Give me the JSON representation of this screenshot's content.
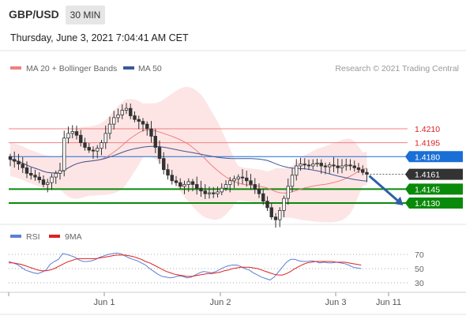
{
  "header": {
    "pair": "GBP/USD",
    "timeframe": "30 MIN"
  },
  "datetime": "Thursday, June 3, 2021 7:04:41 AM CET",
  "legend": {
    "bollinger": {
      "label": "MA 20 + Bollinger Bands",
      "color": "#f08080"
    },
    "ma50": {
      "label": "MA 50",
      "color": "#3b5998"
    },
    "credit": "Research © 2021 Trading Central"
  },
  "rsi_legend": {
    "rsi": {
      "label": "RSI",
      "color": "#5b7fd6"
    },
    "ma9": {
      "label": "9MA",
      "color": "#e02020"
    }
  },
  "colors": {
    "support": "#0a8a0a",
    "resistance": "#f08080",
    "pivot": "#1a6fd6",
    "last": "#333333",
    "arrow": "#2e5fa8"
  },
  "chart_data": {
    "type": "candlestick",
    "price_range": [
      1.4085,
      1.4265
    ],
    "x_labels": [
      "Jun 1",
      "Jun 2",
      "Jun 3",
      "Jun 11"
    ],
    "levels": [
      {
        "value": "1.4210",
        "kind": "resistance"
      },
      {
        "value": "1.4195",
        "kind": "resistance"
      },
      {
        "value": "1.4180",
        "kind": "pivot"
      },
      {
        "value": "1.4161",
        "kind": "last"
      },
      {
        "value": "1.4145",
        "kind": "support"
      },
      {
        "value": "1.4130",
        "kind": "support"
      }
    ],
    "forecast": "down toward 1.4130",
    "closes": [
      1.4177,
      1.4175,
      1.4172,
      1.4168,
      1.4162,
      1.416,
      1.4158,
      1.4155,
      1.415,
      1.4152,
      1.4158,
      1.4162,
      1.4165,
      1.42,
      1.4205,
      1.4207,
      1.4203,
      1.4195,
      1.419,
      1.4187,
      1.4186,
      1.4189,
      1.4195,
      1.4205,
      1.4215,
      1.4222,
      1.4225,
      1.423,
      1.4232,
      1.4224,
      1.422,
      1.4218,
      1.4215,
      1.421,
      1.4202,
      1.419,
      1.4178,
      1.4166,
      1.416,
      1.4154,
      1.4152,
      1.4148,
      1.415,
      1.4153,
      1.415,
      1.4146,
      1.4143,
      1.414,
      1.4141,
      1.414,
      1.4142,
      1.4146,
      1.415,
      1.4154,
      1.4156,
      1.4158,
      1.4157,
      1.4154,
      1.415,
      1.4145,
      1.414,
      1.4132,
      1.4125,
      1.4115,
      1.4112,
      1.4122,
      1.4135,
      1.4148,
      1.416,
      1.417,
      1.4172,
      1.4171,
      1.417,
      1.4172,
      1.4173,
      1.417,
      1.4169,
      1.4171,
      1.417,
      1.4168,
      1.417,
      1.4171,
      1.417,
      1.4168,
      1.4166,
      1.4163,
      1.4161
    ],
    "rsi": {
      "levels": [
        70,
        50,
        30
      ],
      "rsi_values": [
        60,
        58,
        56,
        52,
        48,
        46,
        44,
        43,
        45,
        48,
        56,
        60,
        63,
        71,
        70,
        68,
        66,
        62,
        60,
        60,
        61,
        63,
        66,
        68,
        70,
        71,
        72,
        71,
        68,
        65,
        63,
        61,
        58,
        55,
        50,
        46,
        42,
        39,
        38,
        37,
        38,
        40,
        39,
        37,
        38,
        41,
        44,
        46,
        45,
        44,
        46,
        49,
        52,
        54,
        55,
        55,
        53,
        50,
        48,
        44,
        41,
        38,
        36,
        34,
        38,
        45,
        52,
        59,
        63,
        63,
        61,
        60,
        60,
        61,
        60,
        58,
        59,
        58,
        58,
        59,
        58,
        57,
        55,
        52,
        51,
        50
      ],
      "ma9_values": [
        58,
        58,
        57,
        56,
        54,
        52,
        50,
        48,
        47,
        47,
        48,
        50,
        53,
        56,
        59,
        61,
        63,
        64,
        64,
        64,
        64,
        64,
        65,
        66,
        67,
        68,
        69,
        69,
        69,
        68,
        67,
        65,
        63,
        60,
        58,
        55,
        52,
        49,
        46,
        44,
        42,
        41,
        40,
        39,
        39,
        40,
        41,
        42,
        43,
        43,
        44,
        45,
        47,
        48,
        50,
        51,
        52,
        52,
        52,
        51,
        50,
        48,
        46,
        44,
        42,
        41,
        41,
        43,
        46,
        50,
        53,
        56,
        58,
        59,
        60,
        60,
        60,
        60,
        60,
        59,
        59,
        59,
        58,
        57,
        56,
        55
      ]
    }
  }
}
